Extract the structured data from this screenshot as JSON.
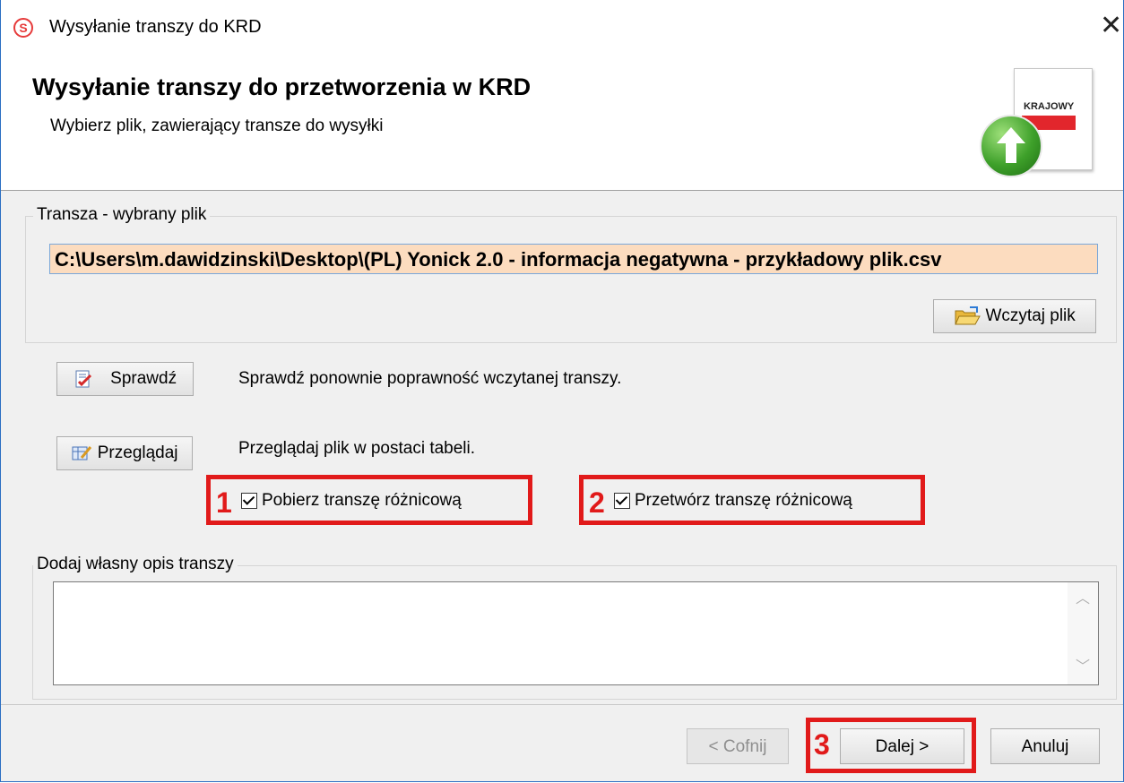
{
  "window": {
    "title": "Wysyłanie transzy do KRD",
    "app_icon": "S"
  },
  "header": {
    "title": "Wysyłanie transzy do przetworzenia w KRD",
    "subtitle": "Wybierz plik, zawierający transze do wysyłki",
    "graphic_label": "KRAJOWY"
  },
  "file_group": {
    "label": "Transza - wybrany plik",
    "path_value": "C:\\Users\\m.dawidzinski\\Desktop\\(PL) Yonick 2.0 - informacja negatywna - przykładowy plik.csv",
    "load_button": "Wczytaj plik"
  },
  "actions": {
    "check_button": "Sprawdź",
    "check_desc": "Sprawdź ponownie poprawność wczytanej transzy.",
    "browse_button": "Przeglądaj",
    "browse_desc": "Przeglądaj plik w postaci tabeli."
  },
  "options": {
    "download_diff": {
      "label": "Pobierz transzę różnicową",
      "checked": true,
      "marker": "1"
    },
    "process_diff": {
      "label": "Przetwórz transzę różnicową",
      "checked": true,
      "marker": "2"
    }
  },
  "description_group": {
    "label": "Dodaj własny opis transzy",
    "value": ""
  },
  "footer": {
    "back_button": "< Cofnij",
    "next_button": "Dalej >",
    "next_marker": "3",
    "cancel_button": "Anuluj"
  },
  "colors": {
    "highlight": "#e11a1a",
    "path_bg": "#fcdcbf",
    "accent_border": "#2b6fc2"
  }
}
